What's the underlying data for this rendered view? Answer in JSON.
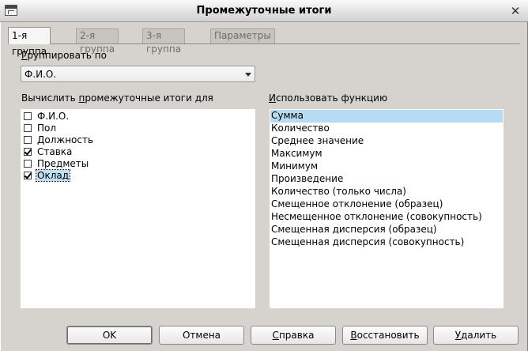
{
  "window": {
    "title": "Промежуточные итоги",
    "close_glyph": "✕"
  },
  "tabs": [
    {
      "label": "1-я группа",
      "active": true
    },
    {
      "label": "2-я группа",
      "active": false
    },
    {
      "label": "3-я группа",
      "active": false
    },
    {
      "label": "Параметры",
      "active": false
    }
  ],
  "group_by": {
    "label_hotkey": "Г",
    "label_rest": "руппировать по",
    "selected_value": "Ф.И.О."
  },
  "calc_for": {
    "label_before": "Вычислить ",
    "label_hotkey": "п",
    "label_after": "ромежуточные итоги для",
    "items": [
      {
        "label": "Ф.И.О.",
        "checked": false
      },
      {
        "label": "Пол",
        "checked": false
      },
      {
        "label": "Должность",
        "checked": false
      },
      {
        "label": "Ставка",
        "checked": true
      },
      {
        "label": "Предметы",
        "checked": false
      },
      {
        "label": "Оклад",
        "checked": true,
        "focused": true
      }
    ]
  },
  "use_function": {
    "label_hotkey": "И",
    "label_rest": "спользовать функцию",
    "items": [
      "Сумма",
      "Количество",
      "Среднее значение",
      "Максимум",
      "Минимум",
      "Произведение",
      "Количество (только числа)",
      "Смещенное отклонение (образец)",
      "Несмещенное отклонение (совокупность)",
      "Смещенная дисперсия (образец)",
      "Смещенная дисперсия (совокупность)"
    ],
    "selected_index": 0
  },
  "buttons": {
    "ok": "OK",
    "cancel": "Отмена",
    "help_hotkey": "С",
    "help_rest": "правка",
    "reset_hotkey": "В",
    "reset_rest": "осстановить",
    "delete_hotkey": "У",
    "delete_rest": "далить"
  },
  "icons": {
    "app": "window-app-icon",
    "close": "close-icon",
    "dropdown": "chevron-down-icon",
    "checkbox": "checkbox-icon"
  }
}
